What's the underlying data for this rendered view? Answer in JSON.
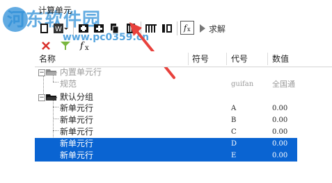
{
  "window": {
    "title": "计算单元"
  },
  "watermark": {
    "site_name": "河东软件园",
    "site_url": "www.pc0359.cn"
  },
  "toolbar": {
    "solve_label": "求解"
  },
  "columns": [
    "名称",
    "符号",
    "代号",
    "数值"
  ],
  "tree": {
    "group_builtin": {
      "label": "内置单元行",
      "child": {
        "name": "规范",
        "code": "guifan",
        "value": "全国通"
      }
    },
    "group_default": {
      "label": "默认分组"
    }
  },
  "rows": [
    {
      "name": "新单元行",
      "code": "A",
      "value": "0.00",
      "selected": false
    },
    {
      "name": "新单元行",
      "code": "B",
      "value": "0.00",
      "selected": false
    },
    {
      "name": "新单元行",
      "code": "C",
      "value": "0.00",
      "selected": false
    },
    {
      "name": "新单元行",
      "code": "D",
      "value": "0.00",
      "selected": true
    },
    {
      "name": "新单元行",
      "code": "E",
      "value": "0.00",
      "selected": true
    }
  ],
  "colors": {
    "selection": "#0a64d2",
    "arrow": "#e8413c",
    "watermark": "#2e8fd8"
  },
  "icons": [
    "document-icon",
    "word-icon",
    "add-row-icon",
    "add-group-icon",
    "copy-icon",
    "delete-icon",
    "matrix-icon",
    "columns-icon",
    "formula-icon",
    "play-icon",
    "close-icon",
    "filter-icon",
    "fx-icon"
  ]
}
